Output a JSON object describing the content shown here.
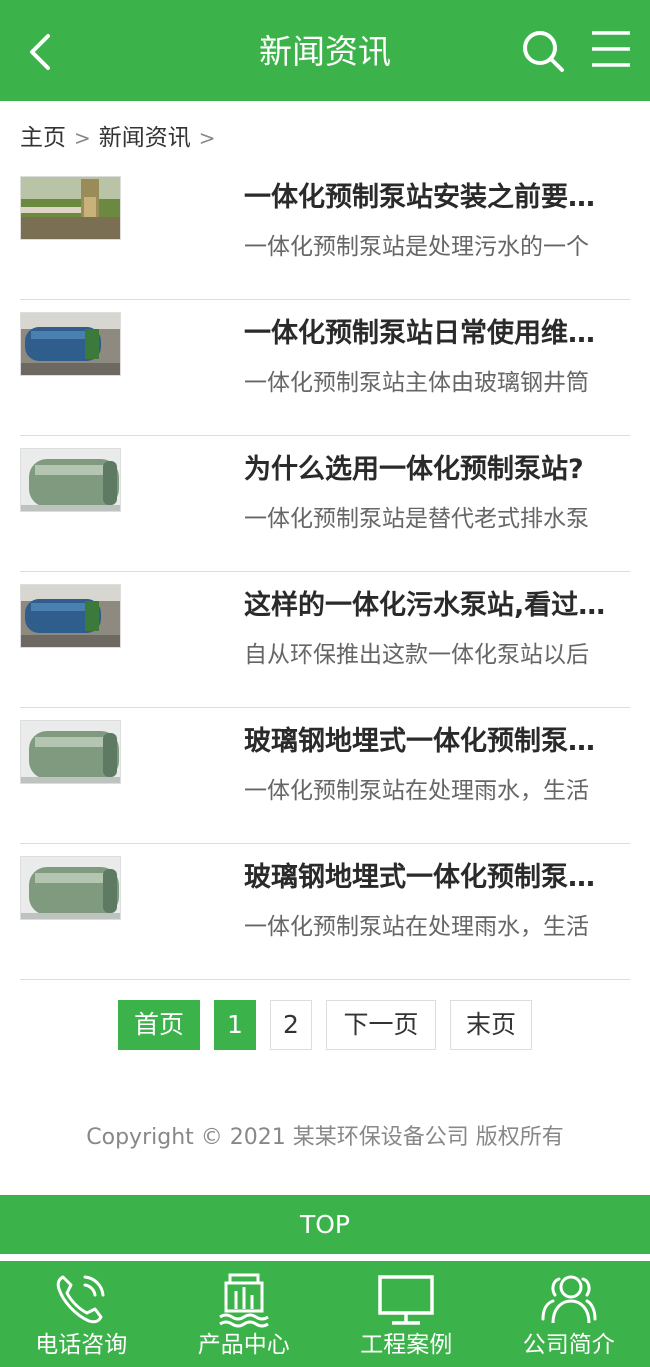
{
  "header": {
    "title": "新闻资讯"
  },
  "breadcrumb": {
    "home": "主页",
    "sep": ">",
    "current": "新闻资讯"
  },
  "news": [
    {
      "title": "一体化预制泵站安装之前要…",
      "desc": "一体化预制泵站是处理污水的一个"
    },
    {
      "title": "一体化预制泵站日常使用维…",
      "desc": "一体化预制泵站主体由玻璃钢井筒"
    },
    {
      "title": "为什么选用一体化预制泵站?",
      "desc": "一体化预制泵站是替代老式排水泵"
    },
    {
      "title": "这样的一体化污水泵站,看过…",
      "desc": "自从环保推出这款一体化泵站以后"
    },
    {
      "title": "玻璃钢地埋式一体化预制泵…",
      "desc": "一体化预制泵站在处理雨水，生活"
    },
    {
      "title": "玻璃钢地埋式一体化预制泵…",
      "desc": "一体化预制泵站在处理雨水，生活"
    }
  ],
  "pager": {
    "first": "首页",
    "page1": "1",
    "page2": "2",
    "next": "下一页",
    "last": "末页"
  },
  "footer": {
    "copyright": "Copyright © 2021 某某环保设备公司 版权所有",
    "top": "TOP"
  },
  "bottom_nav": {
    "phone": "电话咨询",
    "products": "产品中心",
    "cases": "工程案例",
    "about": "公司简介"
  },
  "colors": {
    "brand": "#3cb34a"
  }
}
